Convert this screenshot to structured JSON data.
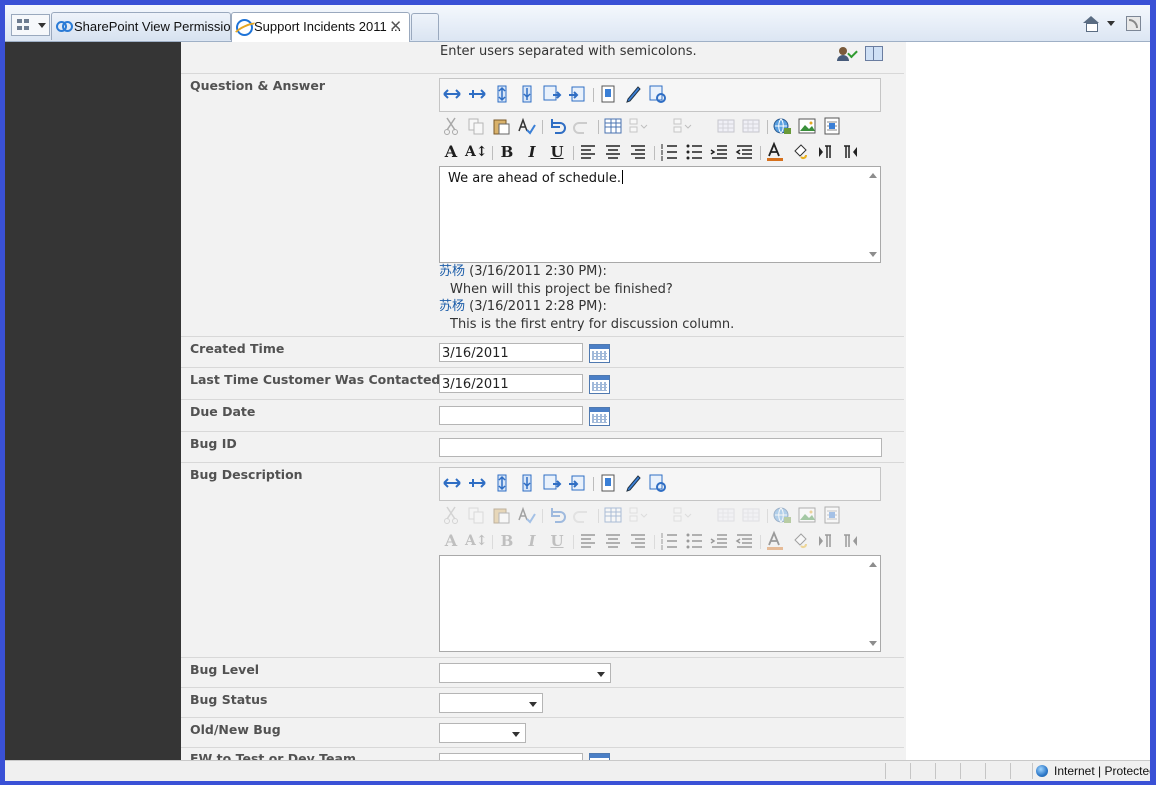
{
  "tabs": [
    {
      "label": "SharePoint View Permissio..."
    },
    {
      "label": "Support Incidents 2011 ...",
      "close": "✕"
    }
  ],
  "form": {
    "people_hint": "Enter users separated with semicolons.",
    "question_answer": {
      "label": "Question & Answer",
      "value": "We are ahead of schedule.",
      "history": [
        {
          "author": "苏杨",
          "time": "(3/16/2011 2:30 PM):",
          "text": "When will this project be finished?"
        },
        {
          "author": "苏杨",
          "time": "(3/16/2011 2:28 PM):",
          "text": "This is the first entry for discussion column."
        }
      ]
    },
    "created_time": {
      "label": "Created Time",
      "value": "3/16/2011"
    },
    "last_contacted": {
      "label": "Last Time Customer Was Contacted",
      "value": "3/16/2011"
    },
    "due_date": {
      "label": "Due Date",
      "value": ""
    },
    "bug_id": {
      "label": "Bug ID",
      "value": ""
    },
    "bug_description": {
      "label": "Bug Description",
      "value": ""
    },
    "bug_level": {
      "label": "Bug Level",
      "value": ""
    },
    "bug_status": {
      "label": "Bug Status",
      "value": ""
    },
    "old_new_bug": {
      "label": "Old/New Bug",
      "value": ""
    },
    "fw_team": {
      "label": "FW to Test or Dev Team"
    }
  },
  "toolbar": {
    "bold": "B",
    "italic": "I",
    "underline": "U",
    "font": "A",
    "font_size": "A↕"
  },
  "status": {
    "zone": "Internet | Protected Mode: Off"
  },
  "icons": {
    "sharepoint_tab": "sharepoint-icon",
    "ie_tab": "ie-icon",
    "home": "home-icon",
    "feeds": "feeds-icon",
    "calendar": "calendar-icon",
    "globe": "globe-icon"
  }
}
